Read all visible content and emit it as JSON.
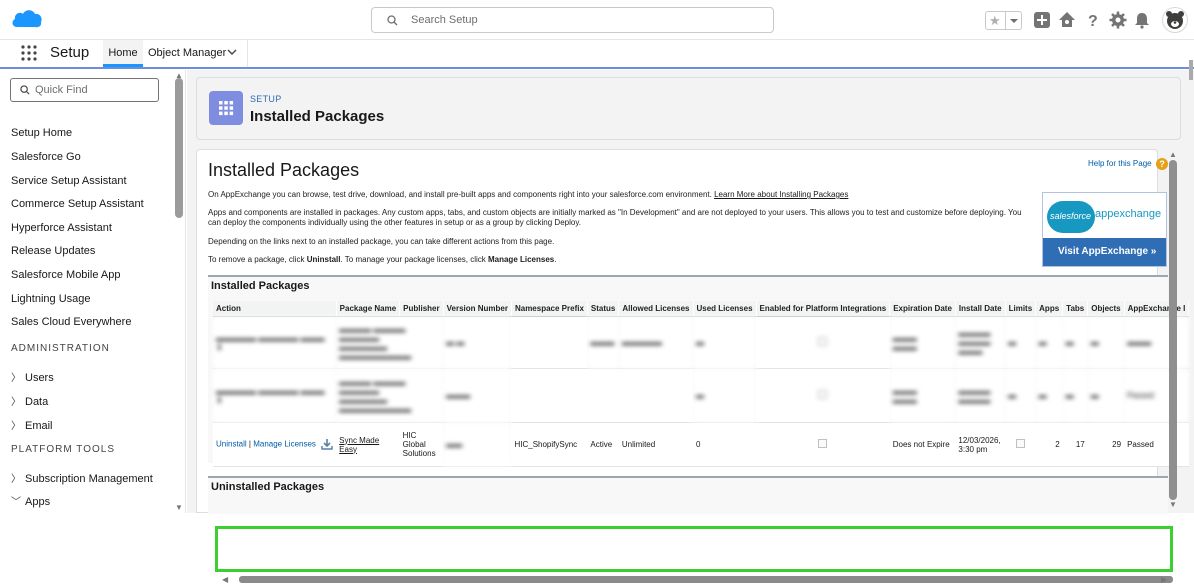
{
  "search": {
    "placeholder": "Search Setup"
  },
  "nav": {
    "app_title": "Setup",
    "tabs": [
      {
        "label": "Home"
      },
      {
        "label": "Object Manager"
      }
    ]
  },
  "sidebar": {
    "quick_find_placeholder": "Quick Find",
    "items": [
      "Setup Home",
      "Salesforce Go",
      "Service Setup Assistant",
      "Commerce Setup Assistant",
      "Hyperforce Assistant",
      "Release Updates",
      "Salesforce Mobile App",
      "Lightning Usage",
      "Sales Cloud Everywhere"
    ],
    "section_admin": "ADMINISTRATION",
    "admin_items": [
      "Users",
      "Data",
      "Email"
    ],
    "section_platform": "PLATFORM TOOLS",
    "platform_items": [
      "Subscription Management",
      "Apps"
    ]
  },
  "header": {
    "eyebrow": "SETUP",
    "title": "Installed Packages"
  },
  "content": {
    "page_title": "Installed Packages",
    "help_link": "Help for this Page",
    "para1_text": "On AppExchange you can browse, test drive, download, and install pre-built apps and components right into your salesforce.com environment. ",
    "para1_link": "Learn More about Installing Packages",
    "para2": "Apps and components are installed in packages. Any custom apps, tabs, and custom objects are initially marked as \"In Development\" and are not deployed to your users. This allows you to test and customize before deploying. You can deploy the components individually using the other features in setup or as a group by clicking Deploy.",
    "para3": "Depending on the links next to an installed package, you can take different actions from this page.",
    "para4_a": "To remove a package, click ",
    "para4_b": "Uninstall",
    "para4_c": ". To manage your package licenses, click ",
    "para4_d": "Manage Licenses",
    "para4_e": ".",
    "appexchange_logo_text": "salesforce",
    "appexchange_word": "appexchange",
    "appexchange_button": "Visit AppExchange »"
  },
  "installed": {
    "heading": "Installed Packages",
    "columns": [
      "Action",
      "Package Name",
      "Publisher",
      "Version Number",
      "Namespace Prefix",
      "Status",
      "Allowed Licenses",
      "Used Licenses",
      "Enabled for Platform Integrations",
      "Expiration Date",
      "Install Date",
      "Limits",
      "Apps",
      "Tabs",
      "Objects",
      "AppExchange I"
    ],
    "highlighted_row": {
      "action_uninstall": "Uninstall",
      "action_sep": " | ",
      "action_manage": "Manage Licenses",
      "package_name": "Sync Made Easy",
      "publisher": "HIC Global Solutions",
      "namespace": "HIC_ShopifySync",
      "status": "Active",
      "allowed_licenses": "Unlimited",
      "used_licenses": "0",
      "expiration": "Does not Expire",
      "install_date": "12/03/2026, 3:30 pm",
      "apps": "2",
      "tabs": "17",
      "objects": "29",
      "appexchange": "Passed"
    },
    "blurred_row2_status": "Passed"
  },
  "uninstalled": {
    "heading": "Uninstalled Packages"
  },
  "colors": {
    "accent": "#1b96ff",
    "highlight": "#3bd02f",
    "header_icon": "#7f8de1",
    "link": "#015ba7"
  }
}
